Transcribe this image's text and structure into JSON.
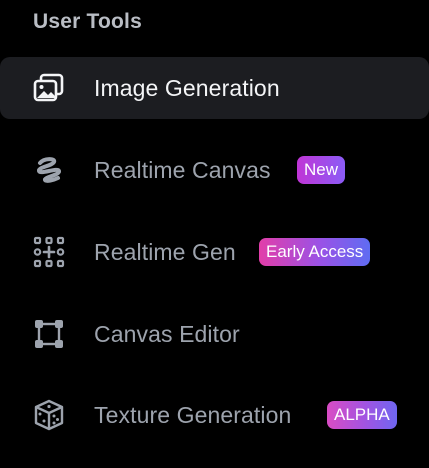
{
  "section": {
    "title": "User Tools"
  },
  "items": [
    {
      "label": "Image Generation",
      "icon": "image-stack-icon",
      "active": true
    },
    {
      "label": "Realtime Canvas",
      "icon": "scribble-icon",
      "badge": "New"
    },
    {
      "label": "Realtime Gen",
      "icon": "dot-grid-plus-icon",
      "badge": "Early Access"
    },
    {
      "label": "Canvas Editor",
      "icon": "vector-square-icon"
    },
    {
      "label": "Texture Generation",
      "icon": "textured-cube-icon",
      "badge": "ALPHA"
    }
  ],
  "colors": {
    "background": "#000000",
    "active_row": "#1c1d21",
    "title": "#b9bdc4",
    "label": "#9da3ad",
    "label_active": "#f4f5f7",
    "badge_gradient_start": "#d23fc0",
    "badge_gradient_end": "#6a68f0"
  }
}
